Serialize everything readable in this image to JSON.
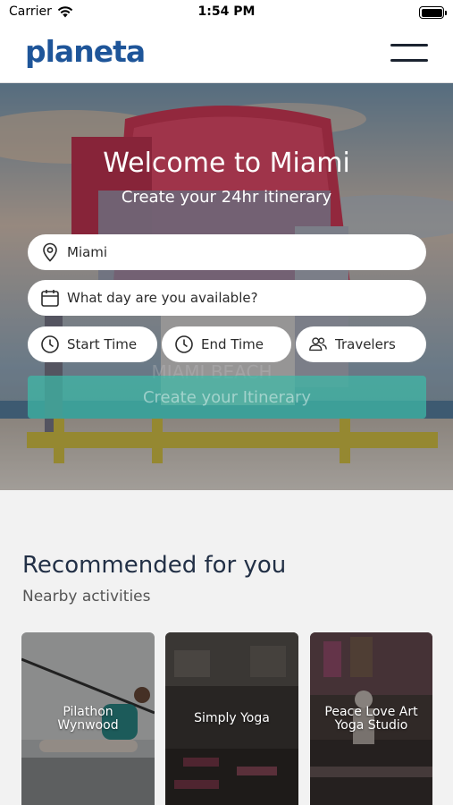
{
  "status_bar": {
    "carrier": "Carrier",
    "time": "1:54 PM",
    "battery_level": 1.0
  },
  "header": {
    "logo": "planeta",
    "menu_icon": "hamburger-menu-icon"
  },
  "hero": {
    "title": "Welcome to Miami",
    "subtitle": "Create your 24hr itinerary",
    "location": {
      "value": "Miami",
      "icon": "map-pin-icon"
    },
    "date": {
      "placeholder": "What day are you available?",
      "icon": "calendar-icon"
    },
    "start_time": {
      "label": "Start Time",
      "icon": "clock-icon"
    },
    "end_time": {
      "label": "End Time",
      "icon": "clock-icon"
    },
    "travelers": {
      "label": "Travelers",
      "icon": "people-icon"
    },
    "cta_label": "Create your Itinerary",
    "cta_color": "#3dbaa8"
  },
  "recommended": {
    "title": "Recommended for you",
    "subtitle": "Nearby activities",
    "cards": [
      {
        "name": "Pilathon\nWynwood"
      },
      {
        "name": "Simply Yoga"
      },
      {
        "name": "Peace Love Art\nYoga Studio"
      }
    ]
  },
  "colors": {
    "brand": "#1e5599",
    "accent": "#3dbaa8",
    "heading": "#223046"
  }
}
